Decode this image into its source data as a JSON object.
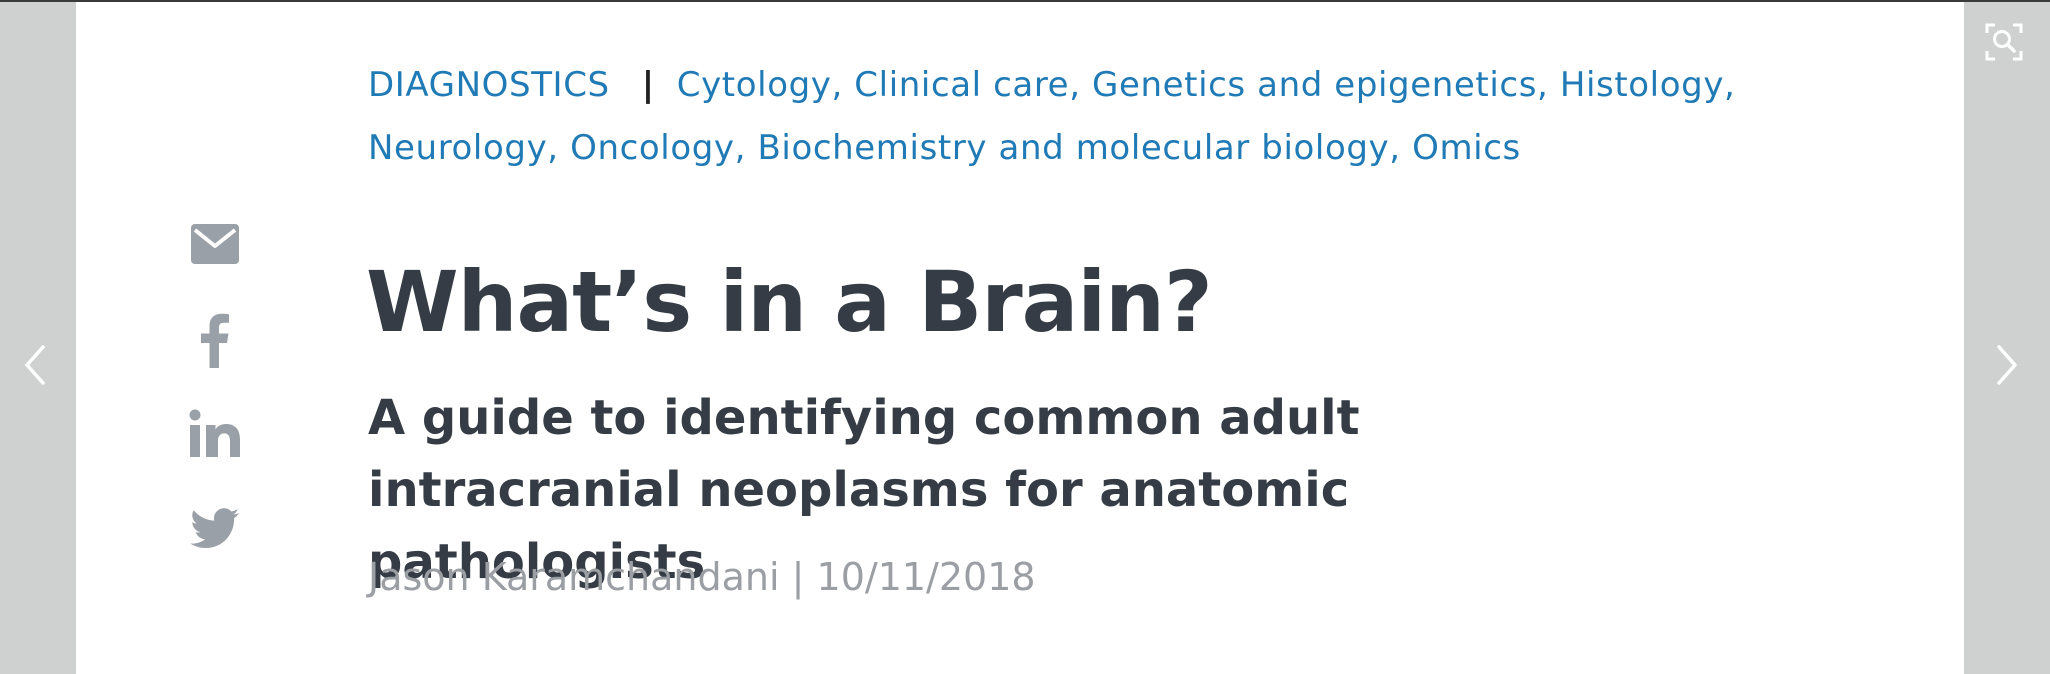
{
  "article": {
    "section": "DIAGNOSTICS",
    "separator": "|",
    "tags_line1": "Cytology, Clinical care, Genetics and epigenetics, Histology,",
    "tags_line2": "Neurology, Oncology, Biochemistry and molecular biology, Omics",
    "title": "What’s in a Brain?",
    "subtitle": "A guide to identifying common adult intracranial neoplasms for anatomic pathologists",
    "author": "Jason Karamchandani",
    "byline_separator": " | ",
    "date": "10/11/2018"
  },
  "share": {
    "icons": [
      "email-icon",
      "facebook-icon",
      "linkedin-icon",
      "twitter-icon"
    ],
    "icon_color": "#9aa0a7"
  },
  "viewer": {
    "prev_icon": "chevron-left-icon",
    "next_icon": "chevron-right-icon",
    "zoom_icon": "zoom-icon"
  },
  "colors": {
    "accent": "#1f7ab6",
    "title": "#353c45",
    "byline": "#9b9fa4",
    "frame": "#cfd0d0"
  }
}
